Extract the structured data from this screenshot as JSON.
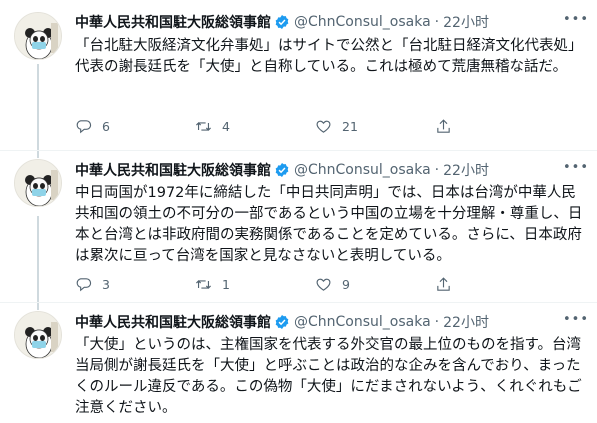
{
  "account": {
    "name": "中華人民共和国駐大阪総領事館",
    "handle": "@ChnConsul_osaka",
    "separator": "·"
  },
  "tweets": [
    {
      "time": "22小时",
      "text": "「台北駐大阪経済文化弁事処」はサイトで公然と「台北駐日経済文化代表処」代表の謝長廷氏を「大使」と自称している。これは極めて荒唐無稽な話だ。",
      "replies": "6",
      "retweets": "4",
      "likes": "21"
    },
    {
      "time": "22小时",
      "text": "中日両国が1972年に締結した「中日共同声明」では、日本は台湾が中華人民共和国の領土の不可分の一部であるという中国の立場を十分理解・尊重し、日本と台湾とは非政府間の実務関係であることを定めている。さらに、日本政府は累次に亘って台湾を国家と見なさないと表明している。",
      "replies": "3",
      "retweets": "1",
      "likes": "9"
    },
    {
      "time": "22小时",
      "text": "「大使」というのは、主権国家を代表する外交官の最上位のものを指す。台湾当局側が謝長廷氏を「大使」と呼ぶことは政治的な企みを含んでおり、まったくのルール違反である。この偽物「大使」にだまされないよう、くれぐれもご注意ください。"
    }
  ],
  "icons": {
    "reply": "reply-icon",
    "retweet": "retweet-icon",
    "like": "heart-icon",
    "share": "share-icon",
    "verified": "verified-badge-icon",
    "more": "more-icon"
  },
  "colors": {
    "text": "#0f1419",
    "secondary": "#536471",
    "verified": "#1d9bf0",
    "thread_line": "#cfd9de"
  }
}
